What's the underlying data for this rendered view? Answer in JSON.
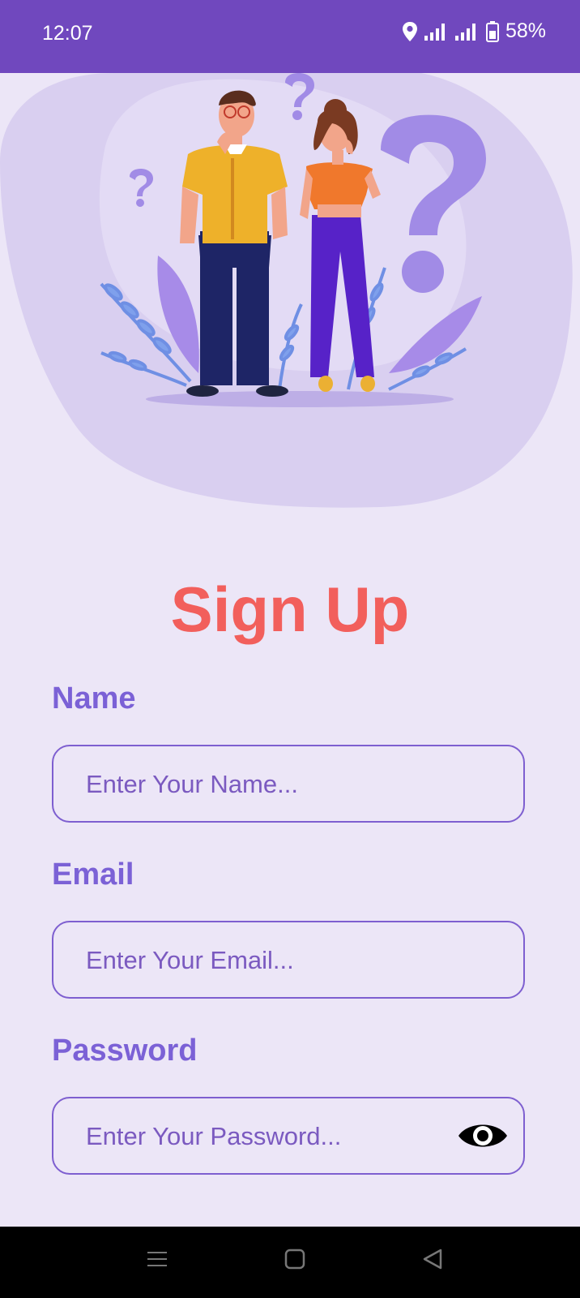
{
  "status_bar": {
    "time": "12:07",
    "battery": "58%",
    "icons": [
      "location-icon",
      "signal-icon",
      "signal-icon",
      "battery-icon"
    ]
  },
  "title": "Sign Up",
  "form": {
    "name": {
      "label": "Name",
      "placeholder": "Enter Your Name..."
    },
    "email": {
      "label": "Email",
      "placeholder": "Enter Your Email..."
    },
    "password": {
      "label": "Password",
      "placeholder": "Enter Your Password...",
      "toggle_icon": "eye-icon"
    }
  },
  "nav_bar": {
    "icons": [
      "menu-icon",
      "home-icon",
      "back-icon"
    ]
  },
  "colors": {
    "status_bar": "#7048BE",
    "background": "#ECE6F7",
    "title": "#F25F5C",
    "label": "#7B61D6",
    "border": "#7E5FD0"
  }
}
